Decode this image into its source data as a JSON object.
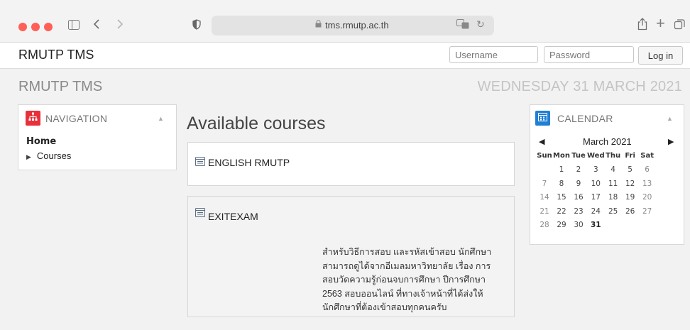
{
  "browser": {
    "url": "tms.rmutp.ac.th",
    "icons": [
      "sidebar-icon",
      "back-icon",
      "forward-icon",
      "privacy-shield-icon",
      "lock-icon",
      "translate-icon",
      "reload-icon",
      "share-icon",
      "new-tab-icon",
      "tabs-overview-icon"
    ]
  },
  "navbar": {
    "brand": "RMUTP TMS",
    "username_placeholder": "Username",
    "password_placeholder": "Password",
    "login_label": "Log in"
  },
  "page": {
    "title": "RMUTP TMS",
    "date": "WEDNESDAY 31 MARCH 2021"
  },
  "navigation": {
    "title": "NAVIGATION",
    "home": "Home",
    "courses": "Courses",
    "icon_color": "#e8303a"
  },
  "main": {
    "title": "Available courses",
    "courses": [
      {
        "name": "ENGLISH RMUTP"
      },
      {
        "name": "EXITEXAM",
        "summary": "สำหรับวิธีการสอบ และรหัสเข้าสอบ นักศึกษาสามารถดูได้จากอีเมลมหาวิทยาลัย เรื่อง การสอบวัดความรู้ก่อนจบการศึกษา ปีการศึกษา 2563 สอบออนไลน์ ที่ทางเจ้าหน้าที่ได้ส่งให้นักศึกษาที่ต้องเข้าสอบทุกคนครับ"
      }
    ]
  },
  "calendar": {
    "title": "CALENDAR",
    "month": "March 2021",
    "icon_color": "#1f7fd4",
    "days": [
      "Sun",
      "Mon",
      "Tue",
      "Wed",
      "Thu",
      "Fri",
      "Sat"
    ],
    "weeks": [
      [
        "",
        "1",
        "2",
        "3",
        "4",
        "5",
        "6"
      ],
      [
        "7",
        "8",
        "9",
        "10",
        "11",
        "12",
        "13"
      ],
      [
        "14",
        "15",
        "16",
        "17",
        "18",
        "19",
        "20"
      ],
      [
        "21",
        "22",
        "23",
        "24",
        "25",
        "26",
        "27"
      ],
      [
        "28",
        "29",
        "30",
        "31",
        "",
        "",
        ""
      ]
    ],
    "today": "31"
  }
}
